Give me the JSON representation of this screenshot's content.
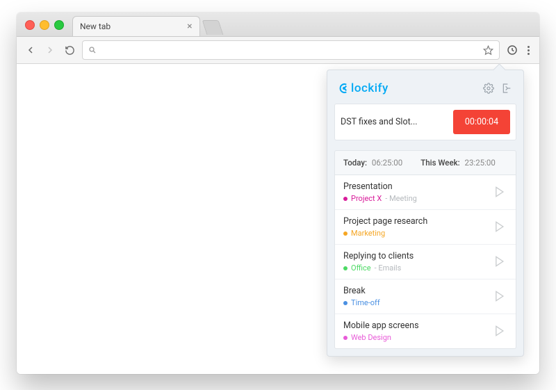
{
  "chrome": {
    "tab_title": "New tab",
    "omnibox_value": "",
    "omnibox_placeholder": ""
  },
  "popup": {
    "brand": "lockify",
    "current": {
      "description": "DST fixes and Slot...",
      "timer": "00:00:04"
    },
    "summary": {
      "today_label": "Today:",
      "today_value": "06:25:00",
      "week_label": "This Week:",
      "week_value": "23:25:00"
    },
    "entries": [
      {
        "title": "Presentation",
        "project": "Project X",
        "task": "Meeting",
        "color": "#d81b9a"
      },
      {
        "title": "Project page research",
        "project": "Marketing",
        "task": "",
        "color": "#f5a623"
      },
      {
        "title": "Replying to clients",
        "project": "Office",
        "task": "Emails",
        "color": "#4cd964"
      },
      {
        "title": "Break",
        "project": "Time-off",
        "task": "",
        "color": "#4a90e2"
      },
      {
        "title": "Mobile app screens",
        "project": "Web Design",
        "task": "",
        "color": "#e85bd8"
      }
    ]
  }
}
